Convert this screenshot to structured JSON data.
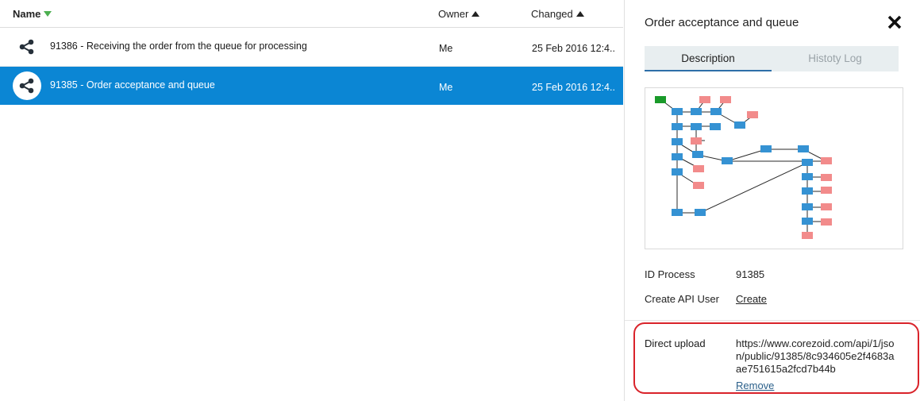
{
  "list": {
    "columns": {
      "name": "Name",
      "owner": "Owner",
      "changed": "Changed"
    },
    "rows": [
      {
        "title": "91386 - Receiving the order from the queue for processing",
        "owner": "Me",
        "changed": "25 Feb 2016 12:4...",
        "icon": "process-share-icon",
        "selected": false
      },
      {
        "title": "91385 - Order acceptance and queue",
        "owner": "Me",
        "changed": "25 Feb 2016 12:4...",
        "icon": "process-share-icon",
        "selected": true
      }
    ]
  },
  "detail": {
    "title": "Order acceptance and queue",
    "tabs": [
      "Description",
      "Histoty Log"
    ],
    "active_tab": "Description",
    "id_process_label": "ID Process",
    "id_process_value": "91385",
    "create_api_user_label": "Create API User",
    "create_api_user_link": "Create",
    "direct_upload_label": "Direct upload",
    "direct_upload_url": "https://www.corezoid.com/api/1/json/public/91385/8c934605e2f4683aae751615a2fcd7b44b",
    "remove_link": "Remove"
  },
  "colors": {
    "selected_row": "#0b86d4",
    "node_blue": "#3592d3",
    "node_pink": "#f28b8b",
    "node_green": "#1a9a2a",
    "highlight": "#d9232a",
    "sort_asc_green": "#4caf50"
  }
}
